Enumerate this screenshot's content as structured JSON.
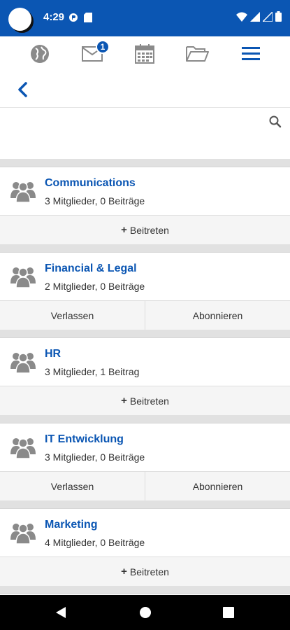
{
  "status": {
    "time": "4:29"
  },
  "nav": {
    "badge": "1"
  },
  "search": {
    "placeholder": ""
  },
  "groups": [
    {
      "name": "Communications",
      "meta": "3 Mitglieder, 0 Beiträge",
      "actions": [
        "Beitreten"
      ]
    },
    {
      "name": "Financial & Legal",
      "meta": "2 Mitglieder, 0 Beiträge",
      "actions": [
        "Verlassen",
        "Abonnieren"
      ]
    },
    {
      "name": "HR",
      "meta": "3 Mitglieder, 1 Beitrag",
      "actions": [
        "Beitreten"
      ]
    },
    {
      "name": "IT Entwicklung",
      "meta": "3 Mitglieder, 0 Beiträge",
      "actions": [
        "Verlassen",
        "Abonnieren"
      ]
    },
    {
      "name": "Marketing",
      "meta": "4 Mitglieder, 0 Beiträge",
      "actions": [
        "Beitreten"
      ]
    }
  ],
  "colors": {
    "primary": "#0b56b3",
    "icon_gray": "#8a8a8a",
    "separator": "#e1e1e1"
  }
}
